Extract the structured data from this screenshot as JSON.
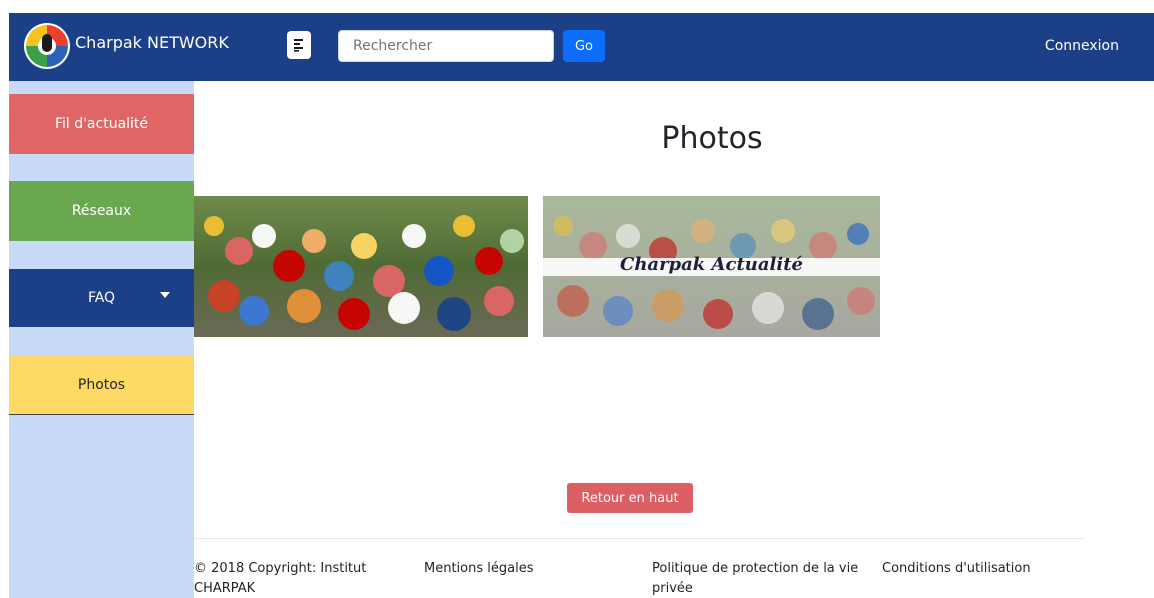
{
  "navbar": {
    "brand": "Charpak NETWORK",
    "search_placeholder": "Rechercher",
    "go_label": "Go",
    "login_label": "Connexion"
  },
  "sidebar": {
    "items": [
      {
        "label": "Fil d'actualité"
      },
      {
        "label": "Réseaux"
      },
      {
        "label": "FAQ"
      },
      {
        "label": "Photos"
      }
    ]
  },
  "main": {
    "title": "Photos",
    "photos": [
      {
        "caption": ""
      },
      {
        "caption": "Charpak Actualité"
      }
    ],
    "back_to_top": "Retour en haut"
  },
  "footer": {
    "copyright": "© 2018 Copyright: Institut CHARPAK",
    "legal": "Mentions légales",
    "privacy": "Politique de protection de la vie privée",
    "terms": "Conditions d'utilisation"
  },
  "colors": {
    "navbar": "#1c4087",
    "sidebar": "#c9daf8",
    "fil": "#e06666",
    "reseaux": "#6aa84f",
    "faq": "#1c4087",
    "photos": "#ffd966",
    "go_button": "#0d6efd",
    "back_button": "#dc5f63"
  }
}
